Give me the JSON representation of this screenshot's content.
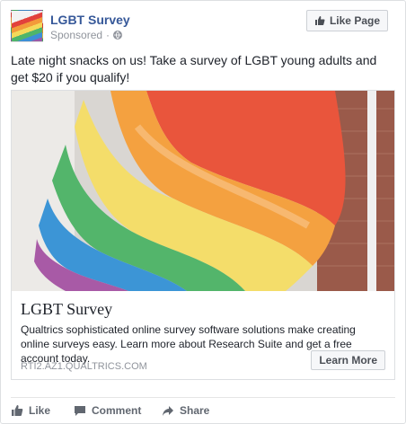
{
  "post": {
    "page_name": "LGBT Survey",
    "sponsored": "Sponsored",
    "like_page_label": "Like Page",
    "message": "Late night snacks on us! Take a survey of LGBT young adults and get $20 if you qualify!"
  },
  "attachment": {
    "title": "LGBT Survey",
    "description": "Qualtrics sophisticated online survey software solutions make creating online surveys easy. Learn more about Research Suite and get a free account today.",
    "caption": "RTI2.AZ1.QUALTRICS.COM",
    "cta_label": "Learn More"
  },
  "actions": {
    "like": "Like",
    "comment": "Comment",
    "share": "Share"
  },
  "icons": {
    "avatar": "rainbow-flag-avatar",
    "privacy": "globe-icon",
    "like_page": "thumbs-up-icon",
    "like": "thumbs-up-icon",
    "comment": "comment-icon",
    "share": "share-icon"
  },
  "colors": {
    "page_name": "#365899",
    "secondary_text": "#90949c",
    "action_text": "#616770",
    "flag": [
      "#e2413c",
      "#f39a3a",
      "#f4d95a",
      "#4fb56a",
      "#3d8fd6",
      "#9b5aa8"
    ]
  }
}
